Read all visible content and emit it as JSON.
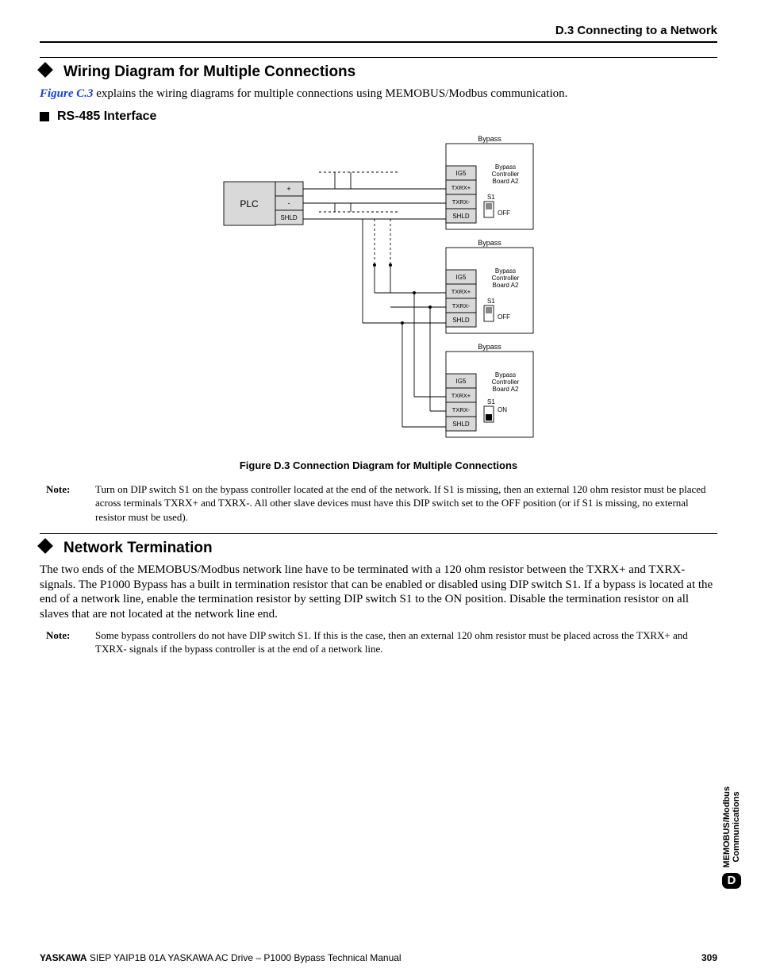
{
  "header": {
    "right": "D.3 Connecting to a Network"
  },
  "section1": {
    "heading": "Wiring Diagram for Multiple Connections",
    "intro_link": "Figure C.3",
    "intro_rest": " explains the wiring diagrams for multiple connections using MEMOBUS/Modbus communication.",
    "sub_heading": "RS-485 Interface"
  },
  "figure": {
    "caption": "Figure D.3  Connection Diagram for Multiple Connections",
    "plc": "PLC",
    "plc_rows": {
      "plus": "+",
      "minus": "-",
      "shld": "SHLD"
    },
    "unit": {
      "title": "Bypass",
      "ig5": "IG5",
      "txrxp": "TXRX+",
      "txrxm": "TXRX-",
      "shld": "SHLD",
      "board": "Bypass Controller Board A2",
      "s1": "S1",
      "off": "OFF",
      "on": "ON"
    }
  },
  "note1": {
    "label": "Note:",
    "body": "Turn on DIP switch S1 on the bypass controller located at the end of the network. If S1 is missing, then an external 120 ohm resistor must be placed across terminals TXRX+ and TXRX-. All other slave devices must have this DIP switch set to the OFF position (or if S1 is missing, no external resistor must be used)."
  },
  "section2": {
    "heading": "Network Termination",
    "body": "The two ends of the MEMOBUS/Modbus network line have to be terminated with a 120 ohm resistor between the TXRX+ and TXRX- signals. The P1000 Bypass has a built in termination resistor that can be enabled or disabled using DIP switch S1. If a bypass is located at the end of a network line, enable the termination resistor by setting DIP switch S1 to the ON position. Disable the termination resistor on all slaves that are not located at the network line end."
  },
  "note2": {
    "label": "Note:",
    "body": "Some bypass controllers do not have DIP switch S1. If this is the case, then an external 120 ohm resistor must be placed across the TXRX+ and TXRX- signals if the bypass controller is at the end of a network line."
  },
  "sidebar": {
    "line1": "MEMOBUS/Modbus",
    "line2": "Communications",
    "letter": "D"
  },
  "footer": {
    "brand": "YASKAWA",
    "rest": " SIEP YAIP1B 01A YASKAWA AC Drive – P1000 Bypass Technical Manual",
    "page": "309"
  }
}
